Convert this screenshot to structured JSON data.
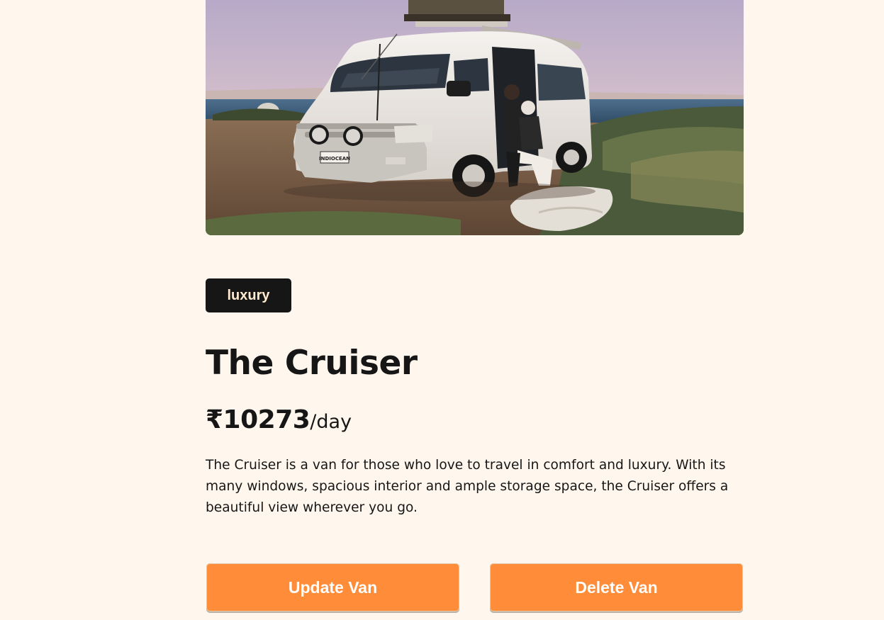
{
  "van": {
    "image_alt": "White camper van parked by the ocean with a couple sitting in the doorway",
    "plate_text": "INDIOCEAN",
    "type": "luxury",
    "name": "The Cruiser",
    "price_amount": "₹10273",
    "price_unit": "/day",
    "description": "The Cruiser is a van for those who love to travel in comfort and luxury. With its many windows, spacious interior and ample storage space, the Cruiser offers a beautiful view wherever you go."
  },
  "actions": {
    "update_label": "Update Van",
    "delete_label": "Delete Van"
  },
  "colors": {
    "page_background": "#FFF7ED",
    "badge_background": "#161616",
    "badge_text": "#FFEAD0",
    "button_background": "#FF8C38",
    "button_text": "#FFFFFF"
  }
}
